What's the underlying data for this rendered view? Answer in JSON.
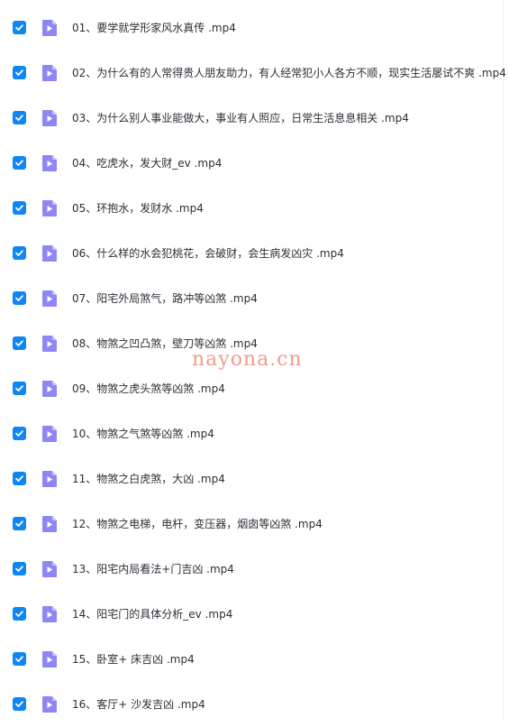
{
  "files": [
    {
      "name": "01、要学就学形家风水真传 .mp4",
      "checked": true
    },
    {
      "name": "02、为什么有的人常得贵人朋友助力，有人经常犯小人各方不顺，现实生活屡试不爽 .mp4",
      "checked": true
    },
    {
      "name": "03、为什么别人事业能做大，事业有人照应，日常生活息息相关 .mp4",
      "checked": true
    },
    {
      "name": "04、吃虎水，发大财_ev .mp4",
      "checked": true
    },
    {
      "name": "05、环抱水，发财水 .mp4",
      "checked": true
    },
    {
      "name": "06、什么样的水会犯桃花，会破财，会生病发凶灾 .mp4",
      "checked": true
    },
    {
      "name": "07、阳宅外局煞气，路冲等凶煞 .mp4",
      "checked": true
    },
    {
      "name": "08、物煞之凹凸煞，壁刀等凶煞 .mp4",
      "checked": true
    },
    {
      "name": "09、物煞之虎头煞等凶煞 .mp4",
      "checked": true
    },
    {
      "name": "10、物煞之气煞等凶煞 .mp4",
      "checked": true
    },
    {
      "name": "11、物煞之白虎煞，大凶 .mp4",
      "checked": true
    },
    {
      "name": "12、物煞之电梯，电杆，变压器，烟囱等凶煞 .mp4",
      "checked": true
    },
    {
      "name": "13、阳宅内局看法+门吉凶 .mp4",
      "checked": true
    },
    {
      "name": "14、阳宅门的具体分析_ev .mp4",
      "checked": true
    },
    {
      "name": "15、卧室+ 床吉凶 .mp4",
      "checked": true
    },
    {
      "name": "16、客厅+ 沙发吉凶 .mp4",
      "checked": true
    }
  ],
  "watermark": "nayona.cn",
  "colors": {
    "checkbox": "#0f86f3",
    "file_icon": "#8f86f5",
    "watermark": "#f08a78"
  }
}
